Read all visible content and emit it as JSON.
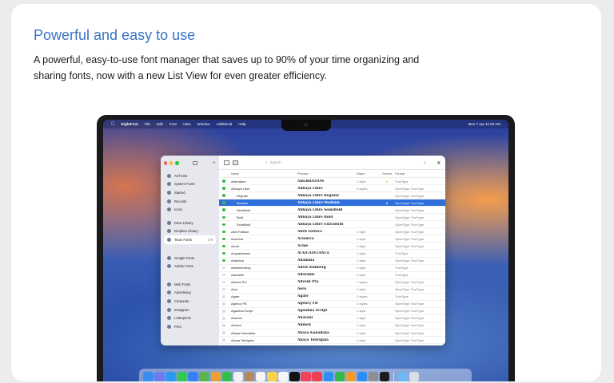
{
  "headline": "Powerful and easy to use",
  "subtext": "A powerful, easy-to-use font manager that saves up to 90% of your time organizing and sharing fonts, now with a new List View for even greater efficiency.",
  "menubar": {
    "items": [
      "RightFont",
      "File",
      "Edit",
      "Font",
      "View",
      "Window",
      "Additional",
      "Help"
    ],
    "clock": "Mon 7 Apr 11:00 AM"
  },
  "window": {
    "sidebar": {
      "items": [
        {
          "label": "All Fonts",
          "count": ""
        },
        {
          "label": "System Fonts",
          "count": ""
        },
        {
          "label": "Starred",
          "count": ""
        },
        {
          "label": "Recents",
          "count": ""
        },
        {
          "label": "Icons",
          "count": ""
        }
      ],
      "libraries": [
        {
          "label": "Drive Library",
          "count": ""
        },
        {
          "label": "Dropbox Library",
          "count": ""
        },
        {
          "label": "Team Fonts",
          "count": "17K",
          "selected": true
        }
      ],
      "services": [
        {
          "label": "Google Fonts"
        },
        {
          "label": "Adobe Fonts"
        }
      ],
      "collections": [
        {
          "label": "Web Fonts"
        },
        {
          "label": "Advertising"
        },
        {
          "label": "Corporate"
        },
        {
          "label": "Instagram"
        },
        {
          "label": "Letterpress"
        },
        {
          "label": "Print"
        }
      ]
    },
    "search_placeholder": "Search",
    "columns": [
      "Name",
      "Preview",
      "Styles",
      "Solved",
      "Format"
    ],
    "rows": [
      {
        "name": "Aberration",
        "preview": "ABERRATION",
        "styles": "1 style",
        "solved": "●",
        "format": "TrueType",
        "dot": "#3bb84a",
        "indent": false,
        "selected": false
      },
      {
        "name": "Abhaya Libre",
        "preview": "Abhaya Libre",
        "styles": "5 styles",
        "solved": "",
        "format": "OpenType TrueType",
        "dot": "#3bb84a",
        "indent": false,
        "selected": false
      },
      {
        "name": "Regular",
        "preview": "Abhaya Libre Regular",
        "styles": "",
        "solved": "",
        "format": "OpenType TrueType",
        "dot": "#3bb84a",
        "indent": true,
        "selected": false
      },
      {
        "name": "Medium",
        "preview": "Abhaya Libre Medium",
        "styles": "",
        "solved": "●",
        "format": "OpenType TrueType",
        "dot": "#3bb84a",
        "indent": true,
        "selected": true
      },
      {
        "name": "SemiBold",
        "preview": "Abhaya Libre SemiBold",
        "styles": "",
        "solved": "",
        "format": "OpenType TrueType",
        "dot": "#3bb84a",
        "indent": true,
        "selected": false
      },
      {
        "name": "Bold",
        "preview": "Abhaya Libre Bold",
        "styles": "",
        "solved": "",
        "format": "OpenType TrueType",
        "dot": "#3bb84a",
        "indent": true,
        "selected": false
      },
      {
        "name": "ExtraBold",
        "preview": "Abhaya Libre ExtraBold",
        "styles": "",
        "solved": "",
        "format": "OpenType TrueType",
        "dot": "#3bb84a",
        "indent": true,
        "selected": false
      },
      {
        "name": "Abril Fatface",
        "preview": "Abril Fatface",
        "styles": "1 style",
        "solved": "",
        "format": "OpenType TrueType",
        "dot": "#3bb84a",
        "indent": false,
        "selected": false
      },
      {
        "name": "Aclonica",
        "preview": "Aclonica",
        "styles": "1 style",
        "solved": "",
        "format": "OpenType TrueType",
        "dot": "#3bb84a",
        "indent": false,
        "selected": false
      },
      {
        "name": "Acme",
        "preview": "Acme",
        "styles": "1 style",
        "solved": "",
        "format": "OpenType TrueType",
        "dot": "#3bb84a",
        "indent": false,
        "selected": false
      },
      {
        "name": "Acquaintance",
        "preview": "ACQUAINTANCE",
        "styles": "1 style",
        "solved": "",
        "format": "TrueType",
        "dot": "#3bb84a",
        "indent": false,
        "selected": false
      },
      {
        "name": "Adamina",
        "preview": "Adamina",
        "styles": "1 style",
        "solved": "",
        "format": "OpenType TrueType",
        "dot": "#3bb84a",
        "indent": false,
        "selected": false
      },
      {
        "name": "Adelekimberg",
        "preview": "Adele Kimberg",
        "styles": "1 style",
        "solved": "",
        "format": "TrueType",
        "dot": "#dddddd",
        "indent": false,
        "selected": false
      },
      {
        "name": "Adorable",
        "preview": "Adorable",
        "styles": "1 style",
        "solved": "",
        "format": "TrueType",
        "dot": "#dddddd",
        "indent": false,
        "selected": false
      },
      {
        "name": "Advent Pro",
        "preview": "Advent Pro",
        "styles": "7 styles",
        "solved": "",
        "format": "OpenType TrueType",
        "dot": "#dddddd",
        "indent": false,
        "selected": false
      },
      {
        "name": "Aero",
        "preview": "Aero",
        "styles": "1 style",
        "solved": "",
        "format": "OpenType TrueType",
        "dot": "#dddddd",
        "indent": false,
        "selected": false
      },
      {
        "name": "Agate",
        "preview": "Agate",
        "styles": "2 styles",
        "solved": "",
        "format": "TrueType",
        "dot": "#dddddd",
        "indent": false,
        "selected": false
      },
      {
        "name": "Agency FB",
        "preview": "Agency FB",
        "styles": "2 styles",
        "solved": "",
        "format": "OpenType TrueType",
        "dot": "#dddddd",
        "indent": false,
        "selected": false
      },
      {
        "name": "Aguafina Script",
        "preview": "Aguafina Script",
        "styles": "1 style",
        "solved": "",
        "format": "OpenType TrueType",
        "dot": "#dddddd",
        "indent": false,
        "selected": false
      },
      {
        "name": "Aharoni",
        "preview": "Aharoni",
        "styles": "1 style",
        "solved": "",
        "format": "OpenType TrueType",
        "dot": "#dddddd",
        "indent": false,
        "selected": false
      },
      {
        "name": "Ahmed",
        "preview": "Ahmed",
        "styles": "1 style",
        "solved": "",
        "format": "OpenType TrueType",
        "dot": "#dddddd",
        "indent": false,
        "selected": false
      },
      {
        "name": "Akaya Kanadaka",
        "preview": "Akaya Kanadaka",
        "styles": "1 style",
        "solved": "",
        "format": "OpenType TrueType",
        "dot": "#dddddd",
        "indent": false,
        "selected": false
      },
      {
        "name": "Akaya Telivigala",
        "preview": "Akaya Telivigala",
        "styles": "1 style",
        "solved": "",
        "format": "OpenType TrueType",
        "dot": "#dddddd",
        "indent": false,
        "selected": false
      }
    ]
  },
  "dock": {
    "apps": [
      {
        "name": "finder-icon",
        "color": "#3a8cf0"
      },
      {
        "name": "launchpad-icon",
        "color": "#6b7cf0"
      },
      {
        "name": "safari-icon",
        "color": "#2a9af2"
      },
      {
        "name": "messages-icon",
        "color": "#34c759"
      },
      {
        "name": "mail-icon",
        "color": "#3a7ef5"
      },
      {
        "name": "maps-icon",
        "color": "#5ab34f"
      },
      {
        "name": "photos-icon",
        "color": "#f0a030"
      },
      {
        "name": "facetime-icon",
        "color": "#32c04a"
      },
      {
        "name": "calendar-icon",
        "color": "#f2f2f2"
      },
      {
        "name": "contacts-icon",
        "color": "#b58a5a"
      },
      {
        "name": "reminders-icon",
        "color": "#f5f5f5"
      },
      {
        "name": "notes-icon",
        "color": "#f7d24a"
      },
      {
        "name": "freeform-icon",
        "color": "#f5f5f5"
      },
      {
        "name": "tv-icon",
        "color": "#111111"
      },
      {
        "name": "music-icon",
        "color": "#f5415a"
      },
      {
        "name": "news-icon",
        "color": "#f04050"
      },
      {
        "name": "keynote-icon",
        "color": "#2e8ff2"
      },
      {
        "name": "numbers-icon",
        "color": "#34b84a"
      },
      {
        "name": "pages-icon",
        "color": "#f39a2a"
      },
      {
        "name": "app-store-icon",
        "color": "#2d8df5"
      },
      {
        "name": "settings-icon",
        "color": "#8e8e93"
      },
      {
        "name": "rightfont-icon",
        "color": "#1c1c1e"
      },
      {
        "name": "downloads-folder-icon",
        "color": "#6fb7f0"
      },
      {
        "name": "trash-icon",
        "color": "#d8dde6"
      }
    ]
  }
}
